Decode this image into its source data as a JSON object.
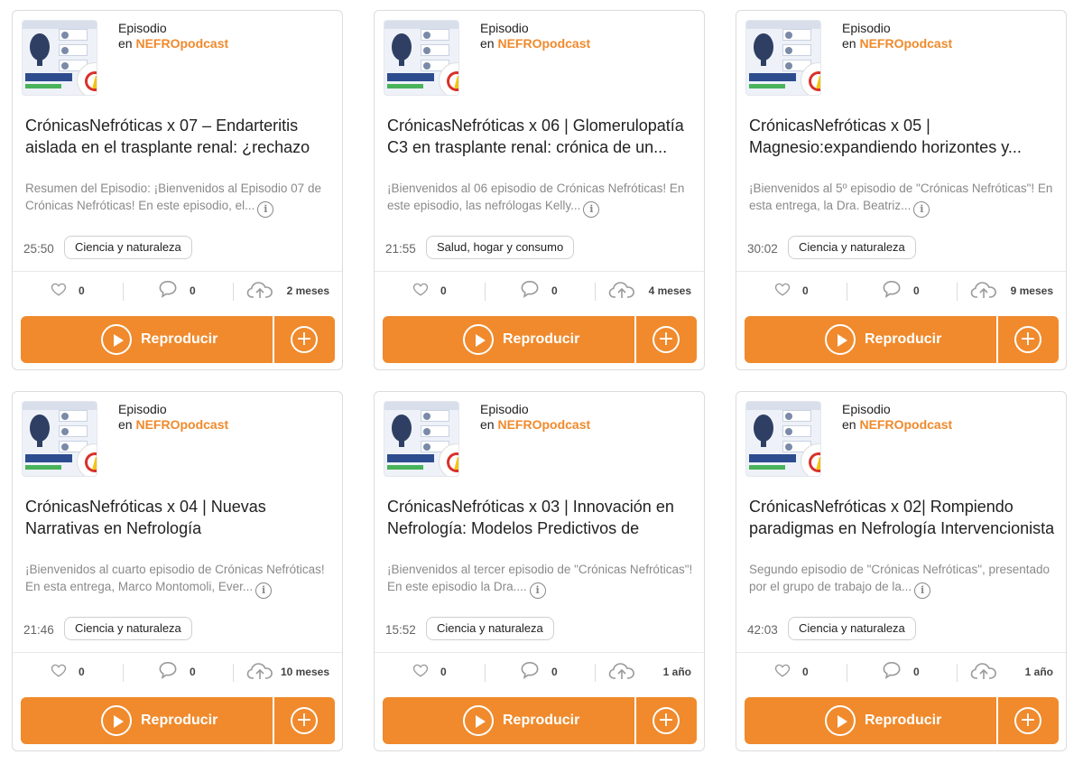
{
  "colors": {
    "accent": "#f08a2c",
    "muted_text": "#8a8a8a",
    "border": "#dcdcdc"
  },
  "icons": {
    "like": "heart-icon",
    "comment": "comment-icon",
    "upload": "cloud-upload-icon",
    "play": "play-icon",
    "add": "plus-icon",
    "info": "info-icon"
  },
  "cards": [
    {
      "type_label": "Episodio",
      "in_label": "en",
      "show": "NEFROpodcast",
      "title": "CrónicasNefróticas x 07 – Endarteritis aislada en el trasplante renal: ¿rechazo o...",
      "description": "Resumen del Episodio: ¡Bienvenidos al Episodio 07 de Crónicas Nefróticas! En este episodio, el...",
      "duration": "25:50",
      "category": "Ciencia y naturaleza",
      "likes": "0",
      "comments": "0",
      "ago": "2 meses",
      "play_label": "Reproducir",
      "info_glyph": "i",
      "add_glyph": "+"
    },
    {
      "type_label": "Episodio",
      "in_label": "en",
      "show": "NEFROpodcast",
      "title": "CrónicasNefróticas x 06 | Glomerulopatía C3 en trasplante renal: crónica de un...",
      "description": "¡Bienvenidos al 06 episodio de Crónicas Nefróticas! En este episodio, las nefrólogas Kelly...",
      "duration": "21:55",
      "category": "Salud, hogar y consumo",
      "likes": "0",
      "comments": "0",
      "ago": "4 meses",
      "play_label": "Reproducir",
      "info_glyph": "i",
      "add_glyph": "+"
    },
    {
      "type_label": "Episodio",
      "in_label": "en",
      "show": "NEFROpodcast",
      "title": "CrónicasNefróticas x 05 | Magnesio:expandiendo horizontes y...",
      "description": "¡Bienvenidos al 5º episodio de \"Crónicas Nefróticas\"! En esta entrega, la Dra. Beatriz...",
      "duration": "30:02",
      "category": "Ciencia y naturaleza",
      "likes": "0",
      "comments": "0",
      "ago": "9 meses",
      "play_label": "Reproducir",
      "info_glyph": "i",
      "add_glyph": "+"
    },
    {
      "type_label": "Episodio",
      "in_label": "en",
      "show": "NEFROpodcast",
      "title": "CrónicasNefróticas x 04 | Nuevas Narrativas en Nefrología",
      "description": "¡Bienvenidos al cuarto episodio de Crónicas Nefróticas! En esta entrega, Marco Montomoli, Ever...",
      "duration": "21:46",
      "category": "Ciencia y naturaleza",
      "likes": "0",
      "comments": "0",
      "ago": "10 meses",
      "play_label": "Reproducir",
      "info_glyph": "i",
      "add_glyph": "+"
    },
    {
      "type_label": "Episodio",
      "in_label": "en",
      "show": "NEFROpodcast",
      "title": "CrónicasNefróticas x 03 | Innovación en Nefrología: Modelos Predictivos de Lesión...",
      "description": "¡Bienvenidos al tercer episodio de \"Crónicas Nefróticas\"! En este episodio la Dra....",
      "duration": "15:52",
      "category": "Ciencia y naturaleza",
      "likes": "0",
      "comments": "0",
      "ago": "1 año",
      "play_label": "Reproducir",
      "info_glyph": "i",
      "add_glyph": "+"
    },
    {
      "type_label": "Episodio",
      "in_label": "en",
      "show": "NEFROpodcast",
      "title": "CrónicasNefróticas x 02| Rompiendo paradigmas en Nefrología Intervencionista",
      "description": "Segundo episodio de \"Crónicas Nefróticas\", presentado por el grupo de trabajo de la...",
      "duration": "42:03",
      "category": "Ciencia y naturaleza",
      "likes": "0",
      "comments": "0",
      "ago": "1 año",
      "play_label": "Reproducir",
      "info_glyph": "i",
      "add_glyph": "+"
    }
  ]
}
